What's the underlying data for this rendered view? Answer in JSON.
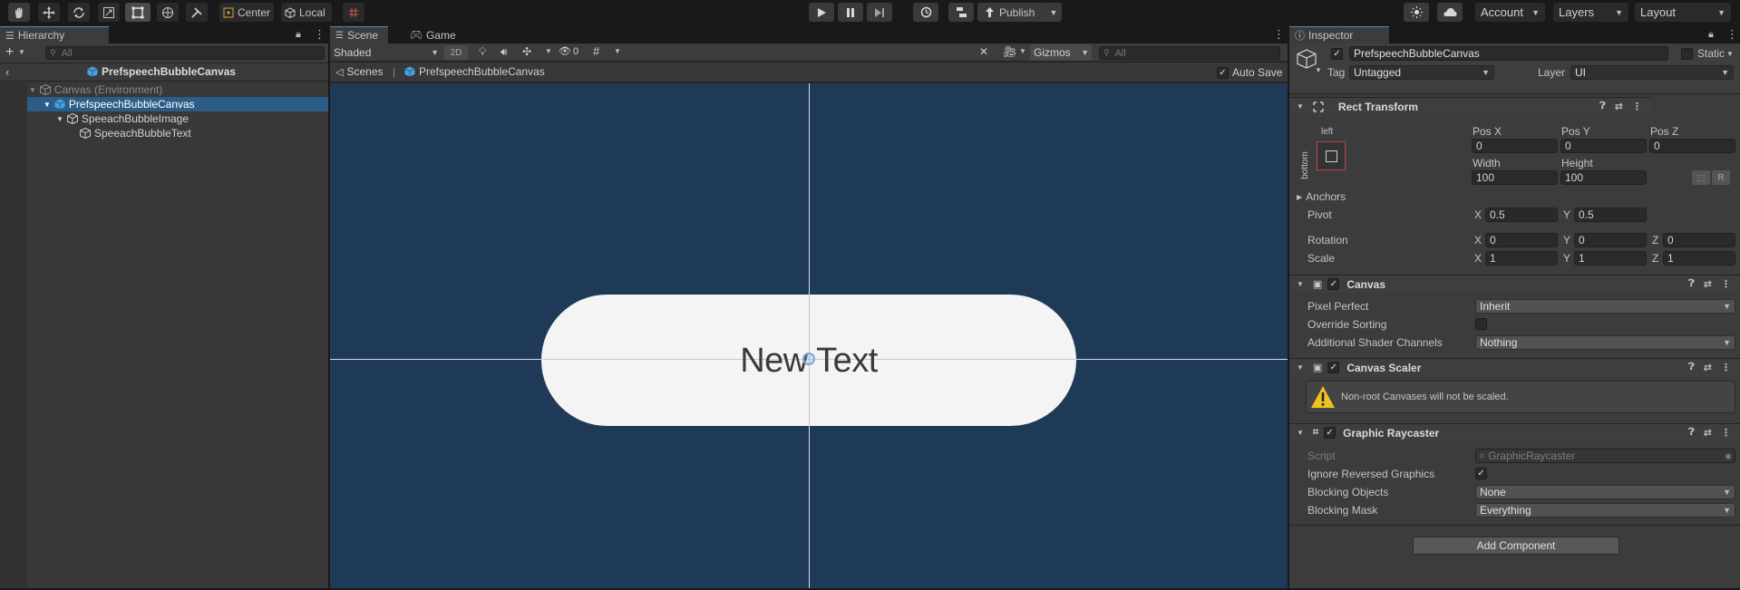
{
  "toolbar": {
    "tools": [
      "hand-icon",
      "move-icon",
      "rotate-icon",
      "scale-icon",
      "rect-icon",
      "transform-icon",
      "custom-tool-icon"
    ],
    "pivot_label": "Center",
    "space_label": "Local",
    "publish_label": "Publish",
    "account_label": "Account",
    "layers_label": "Layers",
    "layout_label": "Layout"
  },
  "hierarchy": {
    "tab_label": "Hierarchy",
    "search_placeholder": "All",
    "prefab_title": "PrefspeechBubbleCanvas",
    "items": [
      {
        "label": "Canvas (Environment)",
        "depth": 0
      },
      {
        "label": "PrefspeechBubbleCanvas",
        "depth": 1
      },
      {
        "label": "SpeeachBubbleImage",
        "depth": 2
      },
      {
        "label": "SpeeachBubbleText",
        "depth": 3
      }
    ]
  },
  "scene": {
    "tabs": [
      "Scene",
      "Game"
    ],
    "shading_mode": "Shaded",
    "mode_2d": "2D",
    "hidden_count": "0",
    "gizmos_label": "Gizmos",
    "search_placeholder": "All",
    "breadcrumb_root": "Scenes",
    "breadcrumb_prefab": "PrefspeechBubbleCanvas",
    "auto_save_label": "Auto Save",
    "bubble_text": "New Text",
    "background_color": "#1f3a57"
  },
  "inspector": {
    "tab_label": "Inspector",
    "object_name": "PrefspeechBubbleCanvas",
    "static_label": "Static",
    "tag_label": "Tag",
    "tag_value": "Untagged",
    "layer_label": "Layer",
    "layer_value": "UI",
    "rect_transform": {
      "title": "Rect Transform",
      "anchor_left": "left",
      "anchor_bottom": "bottom",
      "pos_x_label": "Pos X",
      "pos_x": "0",
      "pos_y_label": "Pos Y",
      "pos_y": "0",
      "pos_z_label": "Pos Z",
      "pos_z": "0",
      "width_label": "Width",
      "width": "100",
      "height_label": "Height",
      "height": "100",
      "r_button": "R",
      "anchors_label": "Anchors",
      "pivot_label": "Pivot",
      "pivot_x": "0.5",
      "pivot_y": "0.5",
      "rotation_label": "Rotation",
      "rot_x": "0",
      "rot_y": "0",
      "rot_z": "0",
      "scale_label": "Scale",
      "scale_x": "1",
      "scale_y": "1",
      "scale_z": "1",
      "x_label": "X",
      "y_label": "Y",
      "z_label": "Z"
    },
    "canvas": {
      "title": "Canvas",
      "pixel_perfect_label": "Pixel Perfect",
      "pixel_perfect_value": "Inherit",
      "override_sorting_label": "Override Sorting",
      "shader_channels_label": "Additional Shader Channels",
      "shader_channels_value": "Nothing"
    },
    "canvas_scaler": {
      "title": "Canvas Scaler",
      "warning": "Non-root Canvases will not be scaled."
    },
    "graphic_raycaster": {
      "title": "Graphic Raycaster",
      "script_label": "Script",
      "script_value": "GraphicRaycaster",
      "ignore_reversed_label": "Ignore Reversed Graphics",
      "blocking_objects_label": "Blocking Objects",
      "blocking_objects_value": "None",
      "blocking_mask_label": "Blocking Mask",
      "blocking_mask_value": "Everything"
    },
    "add_component_label": "Add Component"
  }
}
